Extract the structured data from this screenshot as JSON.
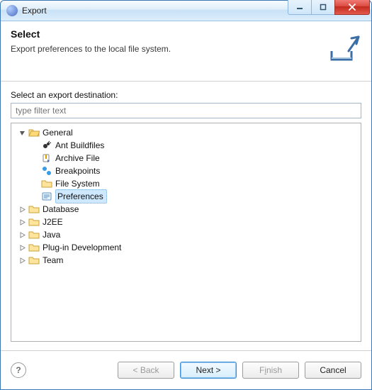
{
  "window": {
    "title": "Export"
  },
  "header": {
    "title": "Select",
    "subtitle": "Export preferences to the local file system."
  },
  "destination_label": "Select an export destination:",
  "filter": {
    "placeholder": "type filter text",
    "value": ""
  },
  "tree": {
    "general": {
      "label": "General",
      "children": {
        "ant": "Ant Buildfiles",
        "archive": "Archive File",
        "breakpoints": "Breakpoints",
        "filesystem": "File System",
        "preferences": "Preferences"
      }
    },
    "database": "Database",
    "j2ee": "J2EE",
    "java": "Java",
    "plugin": "Plug-in Development",
    "team": "Team"
  },
  "footer": {
    "back": "< Back",
    "next": "Next >",
    "finish_pre": "F",
    "finish_mn": "i",
    "finish_post": "nish",
    "cancel": "Cancel"
  }
}
